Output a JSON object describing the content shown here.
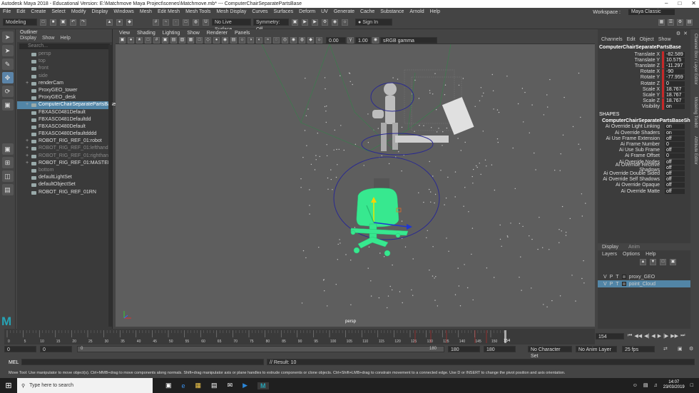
{
  "window": {
    "title": "Autodesk Maya 2018 - Educational Version: E:\\Matchmove Maya Project\\scenes\\Matchmove.mb*  ---  ComputerChairSeparatePartsBase"
  },
  "menubar": {
    "items": [
      "File",
      "Edit",
      "Create",
      "Select",
      "Modify",
      "Display",
      "Windows",
      "Mesh",
      "Edit Mesh",
      "Mesh Tools",
      "Mesh Display",
      "Curves",
      "Surfaces",
      "Deform",
      "UV",
      "Generate",
      "Cache",
      "Substance",
      "Arnold",
      "Help"
    ],
    "workspace_label": "Workspace :",
    "workspace_value": "Maya Classic"
  },
  "statusline": {
    "mode": "Modeling",
    "live_surface": "No Live Surface",
    "symmetry": "Symmetry: Off",
    "sign_in": "Sign In"
  },
  "toolbox": {
    "icons": [
      "select-icon",
      "lasso-icon",
      "paint-icon",
      "move-icon",
      "rotate-icon",
      "scale-icon"
    ]
  },
  "outliner": {
    "title": "Outliner",
    "menu": [
      "Display",
      "Show",
      "Help"
    ],
    "search_placeholder": "Search...",
    "items": [
      {
        "label": "persp",
        "dim": true
      },
      {
        "label": "top",
        "dim": true
      },
      {
        "label": "front",
        "dim": true
      },
      {
        "label": "side",
        "dim": true
      },
      {
        "label": "renderCam",
        "exp": "+"
      },
      {
        "label": "ProxyGEO_tower"
      },
      {
        "label": "ProxyGEO_desk"
      },
      {
        "label": "ComputerChairSeparatePartsBase",
        "sel": true,
        "exp": "+"
      },
      {
        "label": "FBXASC0481Default"
      },
      {
        "label": "FBXASC0481Defaultdd"
      },
      {
        "label": "FBXASC0480Default"
      },
      {
        "label": "FBXASC0480Defaultdddd"
      },
      {
        "label": "ROBOT_RIG_REF_01:robot",
        "exp": "+"
      },
      {
        "label": "ROBOT_RIG_REF_01:lefthand",
        "dim": true,
        "exp": "+"
      },
      {
        "label": "ROBOT_RIG_REF_01:righthand",
        "dim": true,
        "exp": "+"
      },
      {
        "label": "ROBOT_RIG_REF_01:MASTER",
        "exp": "+"
      },
      {
        "label": "bottom",
        "dim": true
      },
      {
        "label": "defaultLightSet"
      },
      {
        "label": "defaultObjectSet"
      },
      {
        "label": "ROBOT_RIG_REF_01RN"
      }
    ]
  },
  "viewport": {
    "menu": [
      "View",
      "Shading",
      "Lighting",
      "Show",
      "Renderer",
      "Panels"
    ],
    "exposure": "0.00",
    "gamma": "1.00",
    "color_space": "sRGB gamma",
    "camera_label": "persp"
  },
  "channelbox": {
    "menu": [
      "Channels",
      "Edit",
      "Object",
      "Show"
    ],
    "object": "ComputerChairSeparatePartsBase",
    "attrs": [
      {
        "n": "Translate X",
        "v": "-82.589"
      },
      {
        "n": "Translate Y",
        "v": "10.575"
      },
      {
        "n": "Translate Z",
        "v": "-11.297"
      },
      {
        "n": "Rotate X",
        "v": "-90"
      },
      {
        "n": "Rotate Y",
        "v": "-77.959"
      },
      {
        "n": "Rotate Z",
        "v": "0"
      },
      {
        "n": "Scale X",
        "v": "18.767"
      },
      {
        "n": "Scale Y",
        "v": "18.767"
      },
      {
        "n": "Scale Z",
        "v": "18.767"
      },
      {
        "n": "Visibility",
        "v": "on"
      }
    ],
    "shapes_header": "SHAPES",
    "shape": "ComputerChairSeparatePartsBaseShape",
    "shape_attrs": [
      {
        "n": "Ai Override Light Linking",
        "v": "on"
      },
      {
        "n": "Ai Override Shaders",
        "v": "on"
      },
      {
        "n": "Ai Use Frame Extension",
        "v": "off"
      },
      {
        "n": "Ai Frame Number",
        "v": "0"
      },
      {
        "n": "Ai Use Sub Frame",
        "v": "off"
      },
      {
        "n": "Ai Frame Offset",
        "v": "0"
      },
      {
        "n": "Ai Override Nodes",
        "v": "off"
      },
      {
        "n": "Ai Override Receive Shadows",
        "v": "off"
      },
      {
        "n": "Ai Override Double Sided",
        "v": "off"
      },
      {
        "n": "Ai Override Self Shadows",
        "v": "off"
      },
      {
        "n": "Ai Override Opaque",
        "v": "off"
      },
      {
        "n": "Ai Override Matte",
        "v": "off"
      }
    ]
  },
  "layers": {
    "tabs": [
      "Display",
      "Anim"
    ],
    "menu": [
      "Layers",
      "Options",
      "Help"
    ],
    "rows": [
      {
        "name": "proxy_GEO",
        "sel": false
      },
      {
        "name": "point_Cloud",
        "sel": true
      }
    ],
    "flags": [
      "V",
      "P",
      "T"
    ]
  },
  "sidetabs": [
    "Channel Box / Layer Editor",
    "Modeling Toolkit",
    "Attribute Editor"
  ],
  "timeline": {
    "ticks": [
      "0",
      "5",
      "10",
      "15",
      "20",
      "25",
      "30",
      "35",
      "40",
      "45",
      "50",
      "55",
      "60",
      "65",
      "70",
      "75",
      "80",
      "85",
      "90",
      "95",
      "100",
      "105",
      "110",
      "115",
      "120",
      "125",
      "130",
      "135",
      "140",
      "145",
      "150"
    ],
    "current": "154",
    "current_marker": "154"
  },
  "range": {
    "start": "0",
    "start2": "0",
    "range_start": "0",
    "range_end": "180",
    "end1": "180",
    "end2": "180",
    "character_set": "No Character Set",
    "anim_layer": "No Anim Layer",
    "fps": "25 fps"
  },
  "cmdline": {
    "label": "MEL",
    "result": "// Result: 10"
  },
  "helpline": "Move Tool: Use manipulator to move object(s). Ctrl+MMB+drag to move components along normals. Shift+drag manipulator axis or plane handles to extrude components or clone objects. Ctrl+Shift+LMB+drag to constrain movement to a connected edge. Use D or INSERT to change the pivot position and axis orientation.",
  "taskbar": {
    "search": "Type here to search",
    "time": "14:07",
    "date": "23/03/2019"
  },
  "colors": {
    "selected": "#5285a6",
    "chair": "#37e88f",
    "key": "#c62828"
  }
}
